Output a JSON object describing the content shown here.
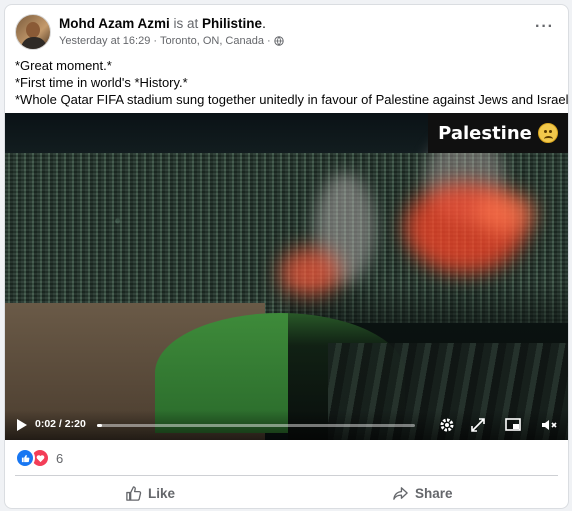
{
  "post": {
    "author": "Mohd Azam Azmi",
    "is_at": "is at",
    "location_tag": "Philistine",
    "period": ".",
    "timestamp": "Yesterday at 16:29",
    "separator": "·",
    "place": "Toronto, ON, Canada",
    "privacy_icon": "globe-icon",
    "more": "···"
  },
  "body": {
    "lines": [
      "*Great moment.*",
      "*First time in world's *History.*",
      "*Whole Qatar FIFA stadium sung together unitedly in favour of Palestine against Jews and Israel."
    ]
  },
  "video": {
    "overlay_text": "Palestine",
    "overlay_icon": "sad-face-emoji",
    "time_display": "0:02 / 2:20",
    "progress_fraction": 0.015,
    "icons": [
      "play-icon",
      "settings-icon",
      "expand-icon",
      "picture-in-picture-icon",
      "fullscreen-icon",
      "mute-icon"
    ]
  },
  "reactions": {
    "types": [
      "like",
      "love"
    ],
    "count": "6"
  },
  "actions": {
    "like_label": "Like",
    "share_label": "Share"
  },
  "colors": {
    "facebook_blue": "#1877f2",
    "love_red": "#f33e58",
    "muted_text": "#65676b"
  }
}
